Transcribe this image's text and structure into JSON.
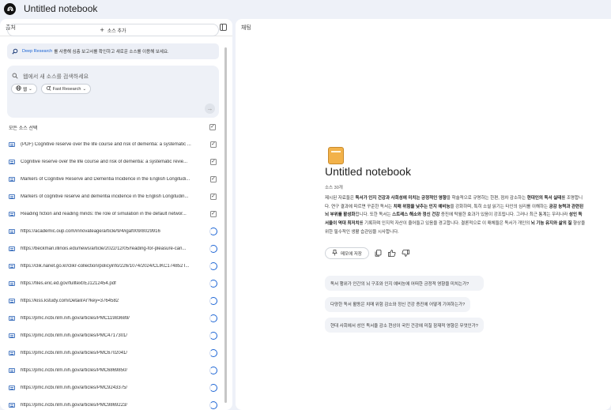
{
  "app": {
    "title": "Untitled notebook"
  },
  "sources_panel": {
    "header": "출처",
    "add_source": "소스 추가",
    "banner": {
      "link": "Deep Research",
      "text": "를 사용해 심층 보고서를 확인하고 새로운 소스를 이용해 보세요."
    },
    "search": {
      "placeholder": "웹에서 새 소스를 검색하세요",
      "scope_chip": "웹",
      "mode_chip": "Fast Research"
    },
    "select_all": "모든 소스 선택",
    "items": [
      {
        "title": "(PDF) Cognitive reserve over the life course and risk of dementia: a systematic ...",
        "status": "checked"
      },
      {
        "title": "Cognitive reserve over the life course and risk of dementia: a systematic revie...",
        "status": "checked"
      },
      {
        "title": "Markers of Cognitive Reserve and Dementia Incidence in the English Longitudi...",
        "status": "checked"
      },
      {
        "title": "Markers of cognitive reserve and dementia incidence in the English Longitudin...",
        "status": "checked"
      },
      {
        "title": "Reading fiction and reading minds: the role of simulation in the default networ...",
        "status": "checked"
      },
      {
        "title": "https://academic.oup.com/innovateage/article/9/4/igaf009/8029916",
        "status": "loading"
      },
      {
        "title": "https://beckman.illinois.edu/news/article/2022/12/05/reading-for-pleasure-can...",
        "status": "loading"
      },
      {
        "title": "https://clik.nanet.go.kr/clikr-collection/policyinfo/226/1074/2024/CLIKC174852T...",
        "status": "loading"
      },
      {
        "title": "https://files.eric.ed.gov/fulltext/EJ1212454.pdf",
        "status": "loading"
      },
      {
        "title": "https://kiss.kstudy.com/Detail/Ar?key=3764582",
        "status": "loading"
      },
      {
        "title": "https://pmc.ncbi.nlm.nih.gov/articles/PMC11983689/",
        "status": "loading"
      },
      {
        "title": "https://pmc.ncbi.nlm.nih.gov/articles/PMC4717301/",
        "status": "loading"
      },
      {
        "title": "https://pmc.ncbi.nlm.nih.gov/articles/PMC6702041/",
        "status": "loading"
      },
      {
        "title": "https://pmc.ncbi.nlm.nih.gov/articles/PMC6869850/",
        "status": "loading"
      },
      {
        "title": "https://pmc.ncbi.nlm.nih.gov/articles/PMC9243375/",
        "status": "loading"
      },
      {
        "title": "https://pmc.ncbi.nlm.nih.gov/articles/PMC9869223/",
        "status": "loading"
      }
    ]
  },
  "chat_panel": {
    "header": "채팅",
    "notebook_title": "Untitled notebook",
    "source_count": "소스 30개",
    "summary": [
      {
        "t": "제시된 자료들은 ",
        "b": false
      },
      {
        "t": "독서가 인지 건강과 사회성에 미치는 긍정적인 영향",
        "b": true
      },
      {
        "t": "을 학술적으로 규명하는 한편, 점차 감소하는 ",
        "b": false
      },
      {
        "t": "현대인의 독서 실태",
        "b": true
      },
      {
        "t": "를 조명합니다. 연구 결과에 따르면 꾸준한 독서는 ",
        "b": false
      },
      {
        "t": "치매 위험을 낮추는 인지 예비능",
        "b": true
      },
      {
        "t": "을 강화하며, 특히 소설 읽기는 타인의 심리를 이해하는 ",
        "b": false
      },
      {
        "t": "공감 능력과 관련된 뇌 부위를 활성화",
        "b": true
      },
      {
        "t": "합니다. 또한 독서는 ",
        "b": false
      },
      {
        "t": "스트레스 해소와 정신 건강",
        "b": true
      },
      {
        "t": " 증진에 탁월한 효과가 있음이 강조됩니다. 그러나 최근 통계는 우리나라 ",
        "b": false
      },
      {
        "t": "성인 독서율이 역대 최저치",
        "b": true
      },
      {
        "t": "를 기록하며 인지적 자산이 줄어들고 있음을 경고합니다. 결론적으로 이 매체들은 독서가 개인의 ",
        "b": false
      },
      {
        "t": "뇌 기능 유지와 삶의 질",
        "b": true
      },
      {
        "t": " 향상을 위한 필수적인 생활 습관임을 시사합니다.",
        "b": false
      }
    ],
    "save_memo": "메모에 저장",
    "suggestions": [
      "독서 행위가 인간의 뇌 구조와 인지 예비능에 어떠한 긍정적 영향을 미치는가?",
      "다양한 독서 활동은 치매 위험 감소와 정신 건강 증진에 어떻게 기여하는가?",
      "현대 사회에서 성인 독서율 감소 현상이 국민 건강에 미칠 잠재적 영향은 무엇인가?"
    ]
  },
  "colors": {
    "accent": "#1a63d4",
    "background": "#eef1f8",
    "panel": "#ffffff"
  }
}
